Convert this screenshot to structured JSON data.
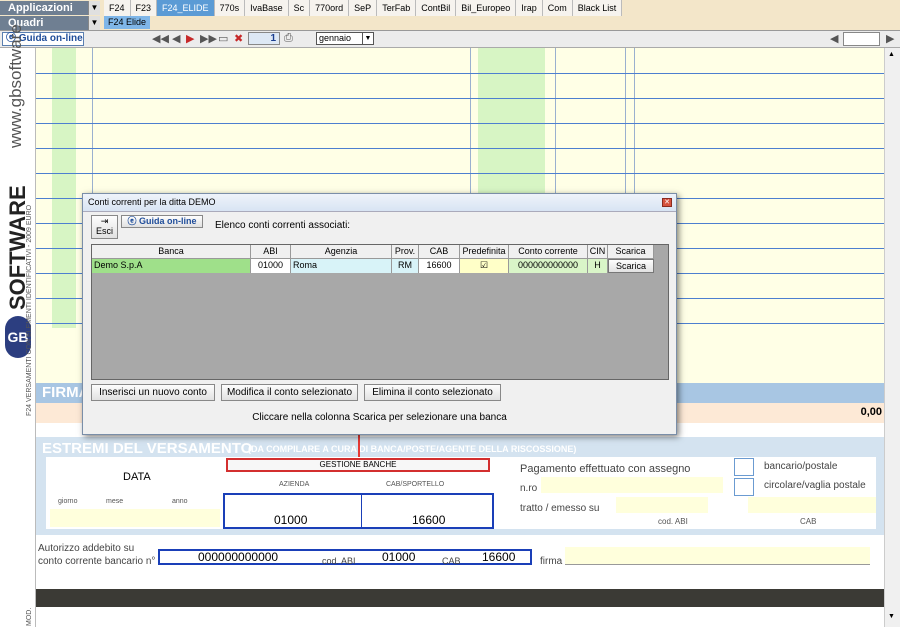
{
  "menus": {
    "applicazioni": "Applicazioni",
    "quadri": "Quadri"
  },
  "tabs": [
    "F24",
    "F23",
    "F24_ELIDE",
    "770s",
    "IvaBase",
    "Sc",
    "770ord",
    "SeP",
    "TerFab",
    "ContBil",
    "Bil_Europeo",
    "Irap",
    "Com",
    "Black List"
  ],
  "subtab": "F24 Elide",
  "toolbar": {
    "guida": "Guida on-line",
    "page": "1",
    "month": "gennaio"
  },
  "sidebar": {
    "brand": "www.gbsoftware",
    "logo": "SOFTWARE",
    "note1": "F24 VERSAMENTI CON ELEMENTI IDENTIFICATIVI - 2009 EURO",
    "note2": "MOD."
  },
  "form": {
    "firma": "FIRMA",
    "amount": "0,00",
    "estremi_title": "ESTREMI DEL VERSAMENTO",
    "estremi_sub": "(DA COMPILARE A CURA DI BANCA/POSTE/AGENTE DELLA RISCOSSIONE)",
    "data_label": "DATA",
    "giorno": "giorno",
    "mese": "mese",
    "anno": "anno",
    "gestione": "GESTIONE BANCHE",
    "azienda": "AZIENDA",
    "cab_sportello": "CAB/SPORTELLO",
    "azienda_val": "01000",
    "cab_val": "16600",
    "pagamento": "Pagamento effettuato con assegno",
    "nro": "n.ro",
    "tratto": "tratto / emesso su",
    "cod_abi": "cod. ABI",
    "cab": "CAB",
    "bancario": "bancario/postale",
    "circolare": "circolare/vaglia postale",
    "autorizzo1": "Autorizzo addebito su",
    "autorizzo2": "conto corrente bancario n°",
    "conto": "000000000000",
    "cod_abi2": "cod. ABI",
    "abi_val": "01000",
    "cab2": "CAB",
    "cab2_val": "16600",
    "firma2": "firma"
  },
  "dialog": {
    "title": "Conti correnti per la ditta DEMO",
    "esci": "Esci",
    "guida": "Guida on-line",
    "elenco": "Elenco conti correnti associati:",
    "columns": [
      "Banca",
      "ABI",
      "Agenzia",
      "Prov.",
      "CAB",
      "Predefinita",
      "Conto corrente",
      "CIN",
      "Scarica"
    ],
    "row": {
      "banca": "Demo S.p.A",
      "abi": "01000",
      "agenzia": "Roma",
      "prov": "RM",
      "cab": "16600",
      "predefinita": "☑",
      "conto": "000000000000",
      "cin": "H",
      "scarica": "Scarica"
    },
    "btn_insert": "Inserisci un nuovo conto",
    "btn_modify": "Modifica il conto selezionato",
    "btn_delete": "Elimina il conto selezionato",
    "hint": "Cliccare nella colonna Scarica per selezionare una banca"
  }
}
